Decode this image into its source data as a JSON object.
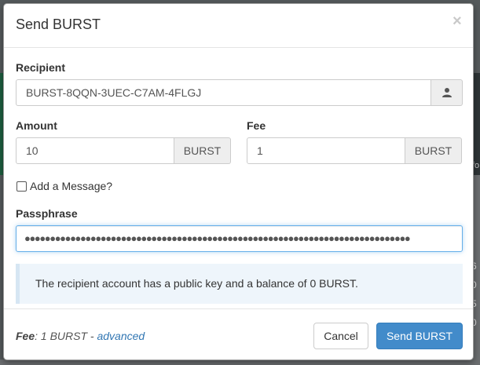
{
  "background": {
    "side_text": "fo",
    "right_numbers": [
      "6",
      "0",
      "5",
      "0"
    ]
  },
  "modal": {
    "title": "Send BURST",
    "close_symbol": "×"
  },
  "recipient": {
    "label": "Recipient",
    "value": "BURST-8QQN-3UEC-C7AM-4FLGJ",
    "button_icon": "user-icon"
  },
  "amount": {
    "label": "Amount",
    "value": "10",
    "unit": "BURST"
  },
  "fee": {
    "label": "Fee",
    "value": "1",
    "unit": "BURST"
  },
  "message": {
    "label": "Add a Message?",
    "checked": false
  },
  "passphrase": {
    "label": "Passphrase",
    "masked_value": "●●●●●●●●●●●●●●●●●●●●●●●●●●●●●●●●●●●●●●●●●●●●●●●●●●●●●●●●●●●●●●●●●●●●●●●●●●●●"
  },
  "info": {
    "text": "The recipient account has a public key and a balance of 0 BURST."
  },
  "footer": {
    "fee_label": "Fee",
    "fee_text": ": 1 BURST - ",
    "advanced_link": "advanced",
    "cancel_label": "Cancel",
    "send_label": "Send BURST"
  },
  "colors": {
    "primary": "#428bca",
    "link": "#3277b3",
    "info_bg": "#eef5fb",
    "info_border": "#d6e6f3",
    "focus_border": "#66afe9"
  }
}
